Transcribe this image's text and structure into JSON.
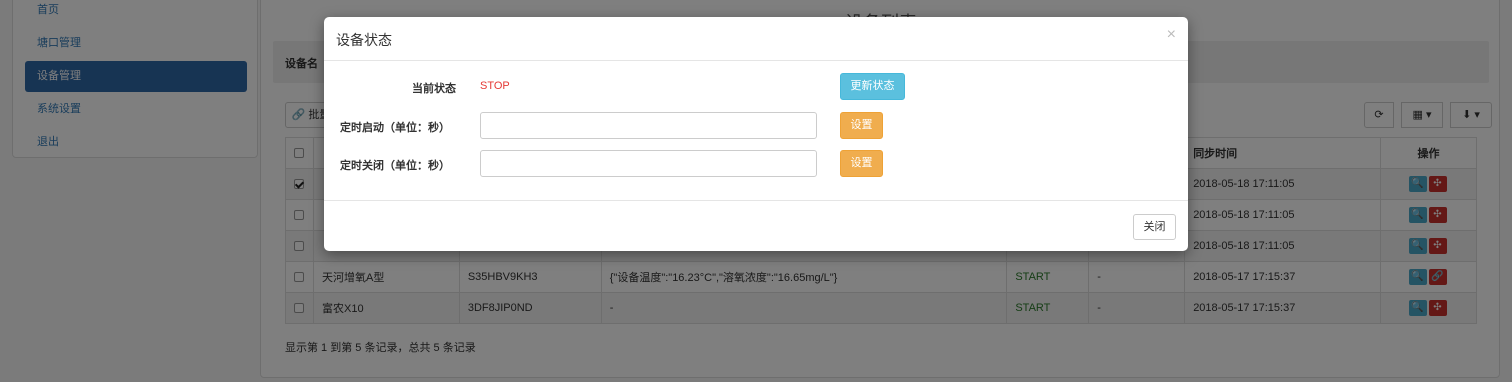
{
  "sidebar": {
    "items": [
      {
        "label": "首页"
      },
      {
        "label": "塘口管理"
      },
      {
        "label": "设备管理"
      },
      {
        "label": "系统设置"
      },
      {
        "label": "退出"
      }
    ]
  },
  "main": {
    "title": "设备列表",
    "search_label": "设备名",
    "batch_button": "批量",
    "toolbar_icons": [
      "refresh-icon",
      "columns-icon",
      "export-icon"
    ],
    "table": {
      "headers": {
        "sync_time": "同步时间",
        "actions": "操作"
      },
      "rows": [
        {
          "checked": true,
          "name": "",
          "code": "",
          "data": "",
          "status": "",
          "remark": "",
          "sync_time": "2018-05-18 17:11:05"
        },
        {
          "checked": false,
          "name": "",
          "code": "",
          "data": "",
          "status": "",
          "remark": "",
          "sync_time": "2018-05-18 17:11:05"
        },
        {
          "checked": false,
          "name": "",
          "code": "",
          "data": "",
          "status": "",
          "remark": "",
          "sync_time": "2018-05-18 17:11:05"
        },
        {
          "checked": false,
          "name": "天河增氧A型",
          "code": "S35HBV9KH3",
          "data": "{\"设备温度\":\"16.23°C\",\"溶氧浓度\":\"16.65mg/L\"}",
          "status": "START",
          "remark": "-",
          "sync_time": "2018-05-17 17:15:37"
        },
        {
          "checked": false,
          "name": "富农X10",
          "code": "3DF8JIP0ND",
          "data": "-",
          "status": "START",
          "remark": "-",
          "sync_time": "2018-05-17 17:15:37"
        }
      ]
    },
    "pagination_text": "显示第 1 到第 5 条记录，总共 5 条记录"
  },
  "modal": {
    "title": "设备状态",
    "close_symbol": "×",
    "current_status_label": "当前状态",
    "current_status_value": "STOP",
    "update_status_button": "更新状态",
    "timer_start_label": "定时启动（单位：秒）",
    "timer_start_value": "",
    "timer_stop_label": "定时关闭（单位：秒）",
    "timer_stop_value": "",
    "set_button": "设置",
    "close_button": "关闭"
  },
  "colors": {
    "status_stop": "#e53935",
    "status_start": "#2b7a2b",
    "active_nav": "#2f68a6",
    "info_button": "#5bc0de",
    "warning_button": "#f0ad4e"
  }
}
